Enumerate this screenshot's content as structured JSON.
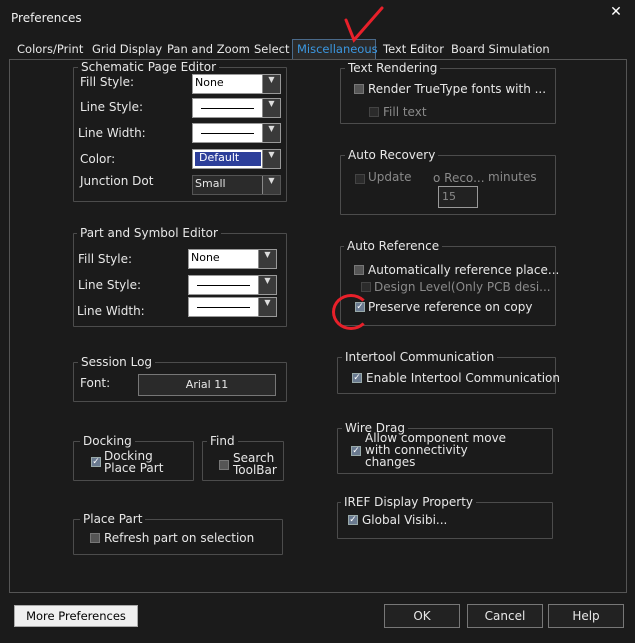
{
  "window": {
    "title": "Preferences",
    "close": "✕"
  },
  "tabs": [
    "Colors/Print",
    "Grid Display",
    "Pan and Zoom",
    "Select",
    "Miscellaneous",
    "Text Editor",
    "Board Simulation"
  ],
  "schematic": {
    "title": "Schematic Page Editor",
    "fill_style_label": "Fill Style:",
    "fill_style_value": "None",
    "line_style_label": "Line Style:",
    "line_width_label": "Line Width:",
    "color_label": "Color:",
    "color_value": "Default",
    "junction_label": "Junction Dot",
    "junction_value": "Small"
  },
  "part_symbol": {
    "title": "Part and Symbol Editor",
    "fill_style_label": "Fill Style:",
    "fill_style_value": "None",
    "line_style_label": "Line Style:",
    "line_width_label": "Line Width:"
  },
  "session_log": {
    "title": "Session Log",
    "font_label": "Font:",
    "font_value": "Arial 11"
  },
  "docking": {
    "title": "Docking",
    "item": "Docking\nPlace Part",
    "item_line1": "Docking",
    "item_line2": "Place Part"
  },
  "find": {
    "title": "Find",
    "item_line1": "Search",
    "item_line2": "ToolBar"
  },
  "place_part": {
    "title": "Place Part",
    "refresh": "Refresh part on selection"
  },
  "text_rendering": {
    "title": "Text Rendering",
    "render_tt": "Render TrueType fonts with ...",
    "fill_text": "Fill text"
  },
  "auto_recovery": {
    "title": "Auto Recovery",
    "update": "Update",
    "recovery": "o Reco...",
    "minutes": "minutes",
    "interval": "15"
  },
  "auto_reference": {
    "title": "Auto Reference",
    "auto_ref": "Automatically reference place...",
    "design_level": "Design Level(Only PCB desi...",
    "preserve": "Preserve reference on copy"
  },
  "intertool": {
    "title": "Intertool Communication",
    "enable": "Enable Intertool Communication"
  },
  "wire_drag": {
    "title": "Wire Drag",
    "line1": "Allow component move",
    "line2": "with connectivity",
    "line3": "changes"
  },
  "iref": {
    "title": "IREF Display Property",
    "global": "Global Visibi..."
  },
  "footer": {
    "more": "More Preferences",
    "ok": "OK",
    "cancel": "Cancel",
    "help": "Help"
  },
  "colors": {
    "accent": "#3b97e0",
    "annotation": "#e8202a"
  }
}
